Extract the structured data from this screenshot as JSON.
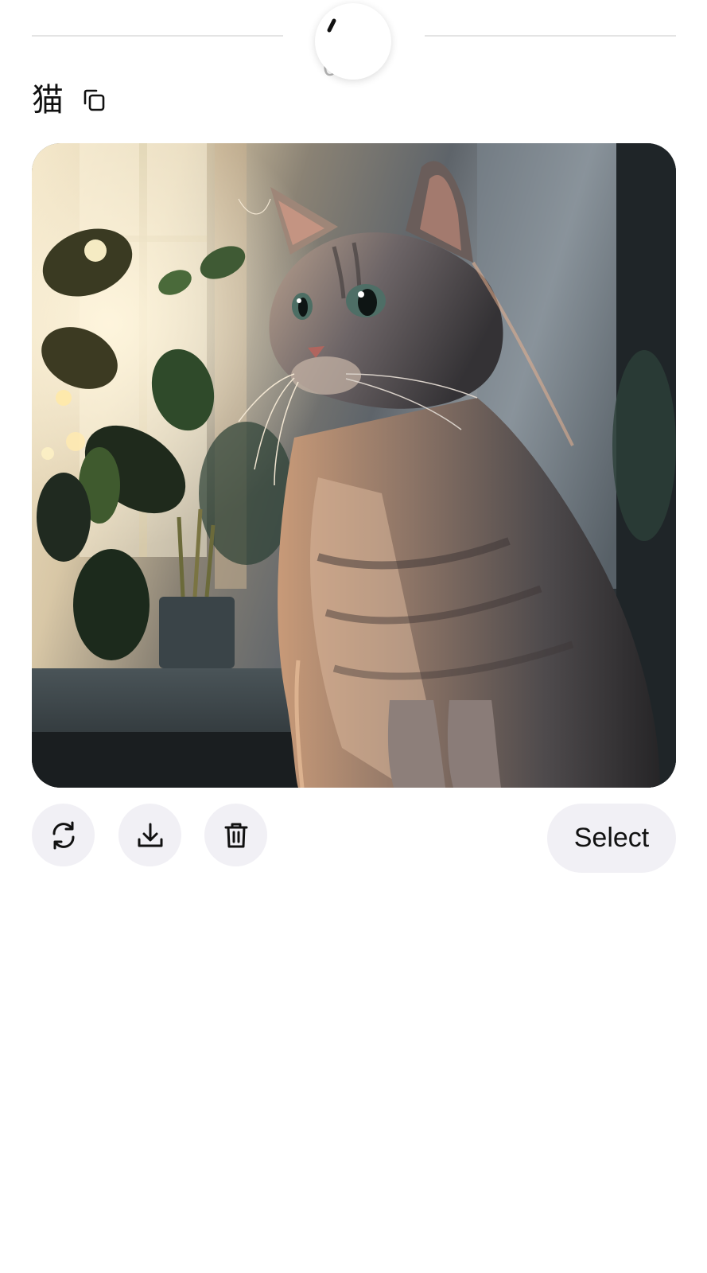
{
  "top_divider": {
    "text": "5 0"
  },
  "prompt": {
    "text": "猫",
    "copy_icon": "copy-icon"
  },
  "image": {
    "alt": "猫",
    "subject_icon": "cat-photo"
  },
  "actions": {
    "regenerate_icon": "refresh-icon",
    "download_icon": "download-icon",
    "delete_icon": "trash-icon",
    "select_label": "Select"
  },
  "colors": {
    "button_bg": "#f1f0f5",
    "divider": "#e4e4e4",
    "text": "#111111"
  }
}
